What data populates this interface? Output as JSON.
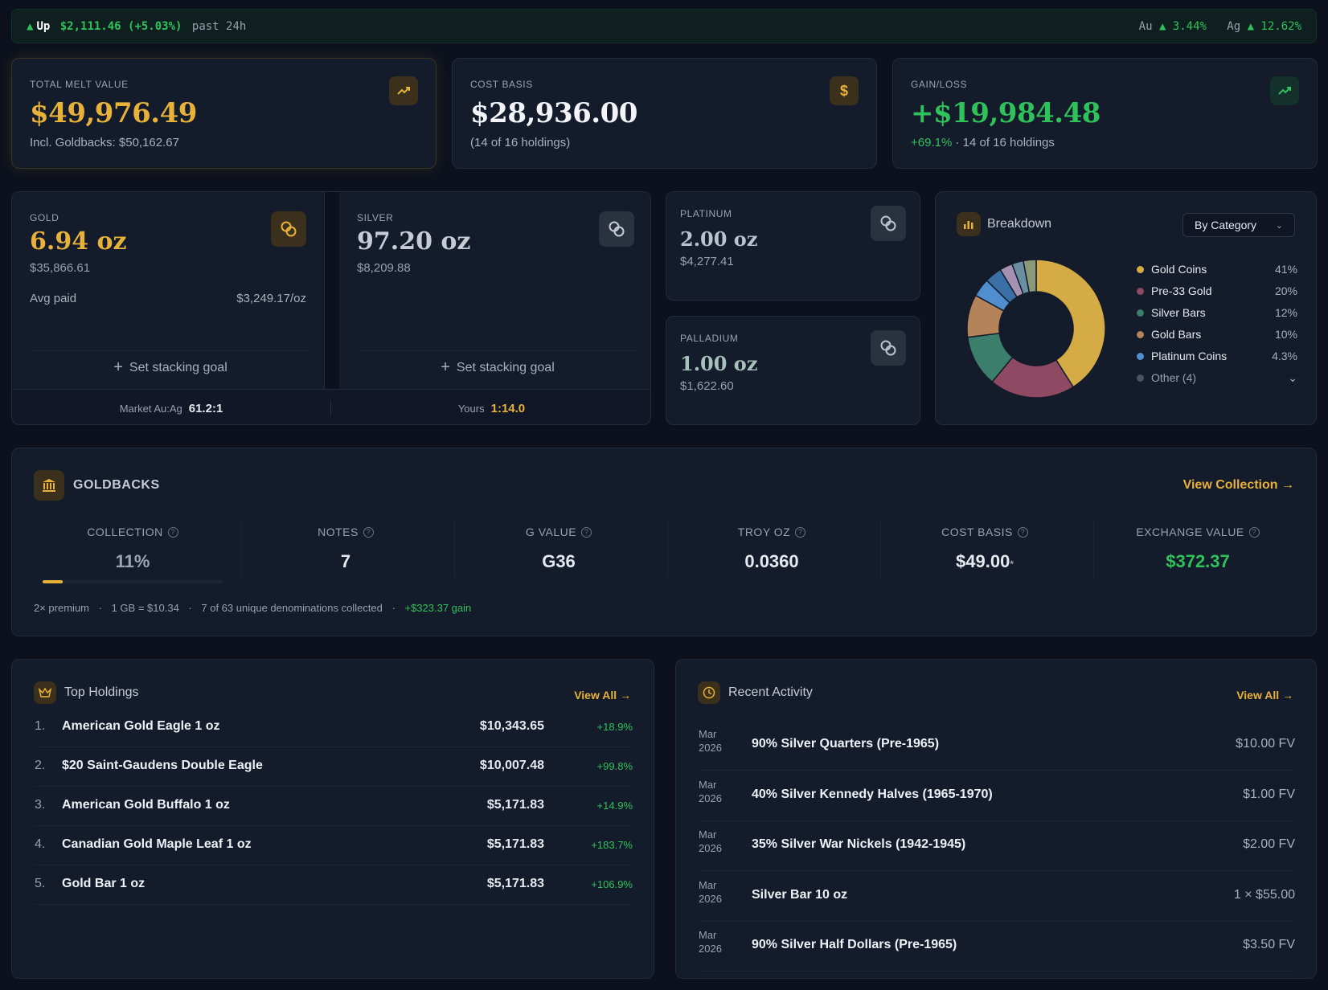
{
  "ticker": {
    "arrow": "▲",
    "up_label": "Up",
    "change": "$2,111.46 (+5.03%)",
    "period": "past 24h",
    "au_label": "Au",
    "au_change": "▲ 3.44%",
    "ag_label": "Ag",
    "ag_change": "▲ 12.62%"
  },
  "summary": {
    "melt": {
      "label": "TOTAL MELT VALUE",
      "value": "$49,976.49",
      "sub": "Incl. Goldbacks: $50,162.67",
      "icon": "trend-up-icon"
    },
    "cost": {
      "label": "COST BASIS",
      "value": "$28,936.00",
      "sub": "(14 of 16 holdings)",
      "icon": "dollar-icon"
    },
    "gain": {
      "label": "GAIN/LOSS",
      "value": "+$19,984.48",
      "pct": "+69.1%",
      "sub": "· 14 of 16 holdings",
      "icon": "trend-up-icon"
    }
  },
  "metals": {
    "gold": {
      "label": "GOLD",
      "oz": "6.94 oz",
      "value": "$35,866.61",
      "avg_label": "Avg paid",
      "avg_value": "$3,249.17/oz",
      "goal": "Set stacking goal"
    },
    "silver": {
      "label": "SILVER",
      "oz": "97.20 oz",
      "value": "$8,209.88",
      "goal": "Set stacking goal"
    },
    "platinum": {
      "label": "PLATINUM",
      "oz": "2.00 oz",
      "value": "$4,277.41"
    },
    "palladium": {
      "label": "PALLADIUM",
      "oz": "1.00 oz",
      "value": "$1,622.60"
    },
    "ratio": {
      "market_label": "Market Au:Ag",
      "market_value": "61.2:1",
      "yours_label": "Yours",
      "yours_value": "1:14.0"
    }
  },
  "breakdown": {
    "title": "Breakdown",
    "select_value": "By Category",
    "items": [
      {
        "label": "Gold Coins",
        "pct": "41%",
        "value": 41,
        "color": "#d4ab45"
      },
      {
        "label": "Pre-33 Gold",
        "pct": "20%",
        "value": 20,
        "color": "#8e4a62"
      },
      {
        "label": "Silver Bars",
        "pct": "12%",
        "value": 12,
        "color": "#3b7e6b"
      },
      {
        "label": "Gold Bars",
        "pct": "10%",
        "value": 10,
        "color": "#b5835a"
      },
      {
        "label": "Platinum Coins",
        "pct": "4.3%",
        "value": 4.3,
        "color": "#4f8fcf"
      }
    ],
    "other_label": "Other (4)",
    "other_segments": [
      {
        "value": 4.0,
        "color": "#3a6fa8"
      },
      {
        "value": 3.0,
        "color": "#a592b3"
      },
      {
        "value": 2.7,
        "color": "#6a8fa0"
      },
      {
        "value": 3.0,
        "color": "#8a9a78"
      }
    ]
  },
  "goldbacks": {
    "title": "GOLDBACKS",
    "view_label": "View Collection →",
    "stats": [
      {
        "label": "COLLECTION",
        "value": "11%",
        "progress": 0.11
      },
      {
        "label": "NOTES",
        "value": "7"
      },
      {
        "label": "G VALUE",
        "value": "G36"
      },
      {
        "label": "TROY OZ",
        "value": "0.0360"
      },
      {
        "label": "COST BASIS",
        "value": "$49.00",
        "asterisk": "*"
      },
      {
        "label": "EXCHANGE VALUE",
        "value": "$372.37"
      }
    ],
    "footer": {
      "premium": "2× premium",
      "rate": "1 GB = $10.34",
      "denoms": "7 of 63 unique denominations collected",
      "gain": "+$323.37 gain"
    }
  },
  "top_holdings": {
    "title": "Top Holdings",
    "view_all": "View All →",
    "rows": [
      {
        "num": "1.",
        "name": "American Gold Eagle 1 oz",
        "amount": "$10,343.65",
        "change": "+18.9%"
      },
      {
        "num": "2.",
        "name": "$20 Saint-Gaudens Double Eagle",
        "amount": "$10,007.48",
        "change": "+99.8%"
      },
      {
        "num": "3.",
        "name": "American Gold Buffalo 1 oz",
        "amount": "$5,171.83",
        "change": "+14.9%"
      },
      {
        "num": "4.",
        "name": "Canadian Gold Maple Leaf 1 oz",
        "amount": "$5,171.83",
        "change": "+183.7%"
      },
      {
        "num": "5.",
        "name": "Gold Bar 1 oz",
        "amount": "$5,171.83",
        "change": "+106.9%"
      }
    ]
  },
  "recent_activity": {
    "title": "Recent Activity",
    "view_all": "View All →",
    "rows": [
      {
        "month": "Mar",
        "year": "2026",
        "name": "90% Silver Quarters (Pre-1965)",
        "amount": "$10.00 FV"
      },
      {
        "month": "Mar",
        "year": "2026",
        "name": "40% Silver Kennedy Halves (1965-1970)",
        "amount": "$1.00 FV"
      },
      {
        "month": "Mar",
        "year": "2026",
        "name": "35% Silver War Nickels (1942-1945)",
        "amount": "$2.00 FV"
      },
      {
        "month": "Mar",
        "year": "2026",
        "name": "Silver Bar 10 oz",
        "amount": "1 × $55.00"
      },
      {
        "month": "Mar",
        "year": "2026",
        "name": "90% Silver Half Dollars (Pre-1965)",
        "amount": "$3.50 FV"
      }
    ]
  }
}
